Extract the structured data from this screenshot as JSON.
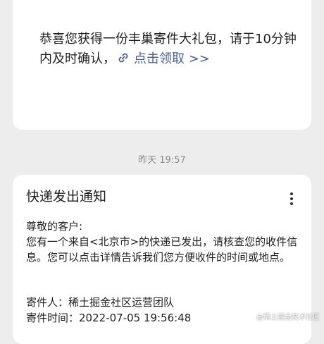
{
  "top_card": {
    "message": "恭喜您获得一份丰巢寄件大礼包，请于10分钟内及时确认，",
    "link_text": "点击领取 >>"
  },
  "timestamp": "昨天 19:57",
  "notification": {
    "title": "快递发出通知",
    "greeting": "尊敬的客户:",
    "body": "您有一个来自<北京市>的快递已发出，请核查您的收件信息。您可以点击详情告诉我们您方便收件的时间或地点。",
    "sender_label": "寄件人：",
    "sender_value": "稀土掘金社区运营团队",
    "time_label": "寄件时间：",
    "time_value": "2022-07-05 19:56:48"
  },
  "watermark": "@稀土掘金技术社区",
  "colors": {
    "link": "#4a5f8e",
    "background": "#ededed",
    "card": "#ffffff"
  },
  "icons": {
    "link": "link-icon",
    "more": "more-vertical-icon"
  }
}
